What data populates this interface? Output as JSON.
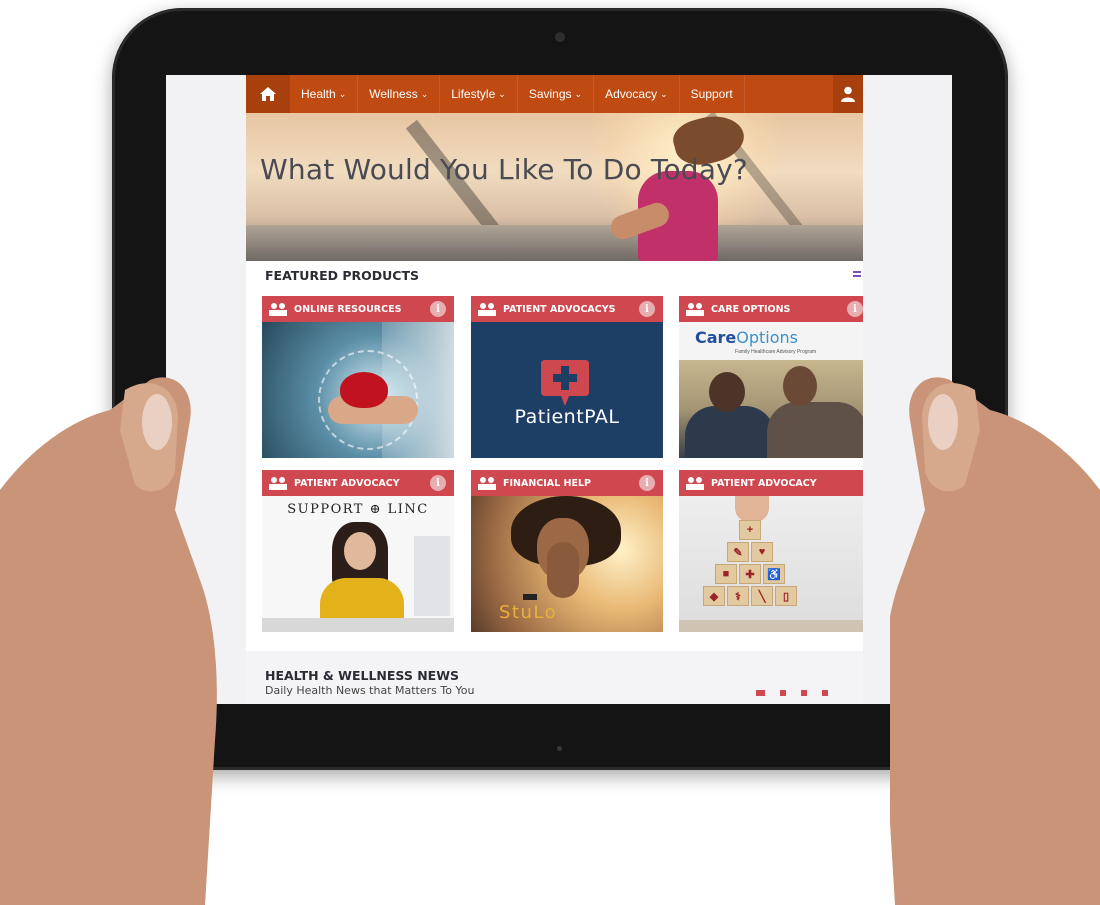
{
  "nav": {
    "items": [
      {
        "label": "Health",
        "chevron": "⌄"
      },
      {
        "label": "Wellness",
        "chevron": "⌄"
      },
      {
        "label": "Lifestyle",
        "chevron": "⌄"
      },
      {
        "label": "Savings",
        "chevron": "⌄"
      },
      {
        "label": "Advocacy",
        "chevron": "⌄"
      },
      {
        "label": "Support",
        "chevron": ""
      }
    ],
    "home_icon": "home-icon",
    "user_icon": "user-icon",
    "color": "#bf4b12"
  },
  "hero": {
    "title": "What Would You Like To Do Today?"
  },
  "featured": {
    "title": "FEATURED PRODUCTS",
    "cards": [
      {
        "label": "ONLINE RESOURCES",
        "info": "i"
      },
      {
        "label": "PATIENT ADVOCACYS",
        "info": "i",
        "image_text": "PatientPAL"
      },
      {
        "label": "CARE OPTIONS",
        "info": "i",
        "image_text": "CareOptions",
        "image_text_a": "Care",
        "image_text_b": "Options",
        "image_sub": "Family Healthcare Advisory Program"
      },
      {
        "label": "PATIENT ADVOCACY",
        "info": "i",
        "image_text": "Support Linc",
        "image_text_a": "SUPPORT",
        "image_text_b": "LINC"
      },
      {
        "label": "FINANCIAL HELP",
        "info": "i",
        "image_text": "StuLo"
      },
      {
        "label": "PATIENT ADVOCACY",
        "info": ""
      }
    ],
    "header_color": "#d0484f"
  },
  "news": {
    "title": "HEALTH & WELLNESS NEWS",
    "subtitle": "Daily Health News that Matters To You",
    "pager_count": 4
  }
}
